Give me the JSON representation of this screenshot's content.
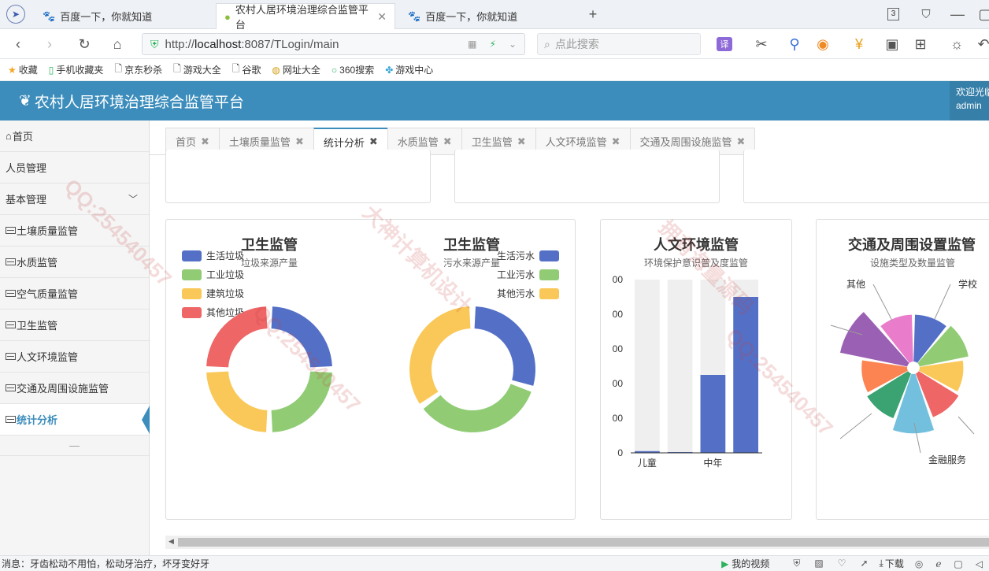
{
  "browser": {
    "tabs": [
      {
        "label": "百度一下，你就知道",
        "active": false
      },
      {
        "label": "农村人居环境治理综合监管平台",
        "active": true
      },
      {
        "label": "百度一下，你就知道",
        "active": false
      }
    ],
    "new_tab": "+",
    "tab_count": "3",
    "url_prefix": "http://",
    "url_host": "localhost",
    "url_rest": ":8087/TLogin/main",
    "search_placeholder": "点此搜索",
    "bookmarks": [
      "收藏",
      "手机收藏夹",
      "京东秒杀",
      "游戏大全",
      "谷歌",
      "网址大全",
      "360搜索",
      "游戏中心"
    ]
  },
  "app": {
    "title": "农村人居环境治理综合监管平台",
    "welcome": "欢迎光临",
    "user": "admin"
  },
  "sidebar": {
    "items": [
      {
        "label": "首页",
        "icon": "home-icon"
      },
      {
        "label": "人员管理"
      },
      {
        "label": "基本管理",
        "expandable": true
      },
      {
        "label": "土壤质量监管",
        "icon": "table-icon"
      },
      {
        "label": "水质监管",
        "icon": "table-icon"
      },
      {
        "label": "空气质量监管",
        "icon": "table-icon"
      },
      {
        "label": "卫生监管",
        "icon": "table-icon"
      },
      {
        "label": "人文环境监管",
        "icon": "table-icon"
      },
      {
        "label": "交通及周围设施监管",
        "icon": "table-icon"
      },
      {
        "label": "统计分析",
        "icon": "table-icon",
        "active": true
      }
    ]
  },
  "page_tabs": [
    {
      "label": "首页"
    },
    {
      "label": "土壤质量监管"
    },
    {
      "label": "统计分析",
      "active": true
    },
    {
      "label": "水质监管"
    },
    {
      "label": "卫生监管"
    },
    {
      "label": "人文环境监管"
    },
    {
      "label": "交通及周围设施监管"
    }
  ],
  "colors": {
    "blue": "#5470c6",
    "green": "#91cc75",
    "yellow": "#fac858",
    "red": "#ee6666",
    "cyan": "#73c0de",
    "teal": "#3ba272",
    "orange": "#fc8452",
    "purple": "#9a60b4",
    "pink": "#ea7ccc",
    "header": "#3c8dbc"
  },
  "chart_data": [
    {
      "type": "pie",
      "title": "卫生监管",
      "subtitle": "垃圾来源产量",
      "donut": true,
      "legend_position": "top-left",
      "categories": [
        "生活垃圾",
        "工业垃圾",
        "建筑垃圾",
        "其他垃圾"
      ],
      "values": [
        25,
        25,
        25,
        25
      ]
    },
    {
      "type": "pie",
      "title": "卫生监管",
      "subtitle": "污水来源产量",
      "donut": true,
      "legend_position": "top-right",
      "categories": [
        "生活污水",
        "工业污水",
        "其他污水"
      ],
      "values": [
        30,
        35,
        35
      ]
    },
    {
      "type": "bar",
      "title": "人文环境监管",
      "subtitle": "环境保护意识普及度监管",
      "categories": [
        "儿童",
        "",
        "中年",
        ""
      ],
      "x_tick_labels": [
        "儿童",
        "中年"
      ],
      "values": [
        10,
        0,
        450,
        900
      ],
      "ylim": [
        0,
        1000
      ],
      "y_tick_labels": [
        "0",
        "00",
        "00",
        "00",
        "00",
        "00"
      ],
      "background_bars": true
    },
    {
      "type": "pie",
      "title": "交通及周围设置监管",
      "subtitle": "设施类型及数量监管",
      "rose": true,
      "labels_visible": [
        "其他",
        "学校",
        "金融服务"
      ],
      "values": [
        60,
        65,
        55,
        60,
        80,
        62,
        58,
        95,
        60
      ]
    }
  ],
  "status_bar": {
    "message": "消息：牙齿松动不用怕，松动牙治疗，坏牙变好牙",
    "video": "我的视频",
    "download": "下载"
  },
  "watermarks": [
    "QQ:254540457",
    "大神计算机设计",
    "拥有海量源码"
  ]
}
